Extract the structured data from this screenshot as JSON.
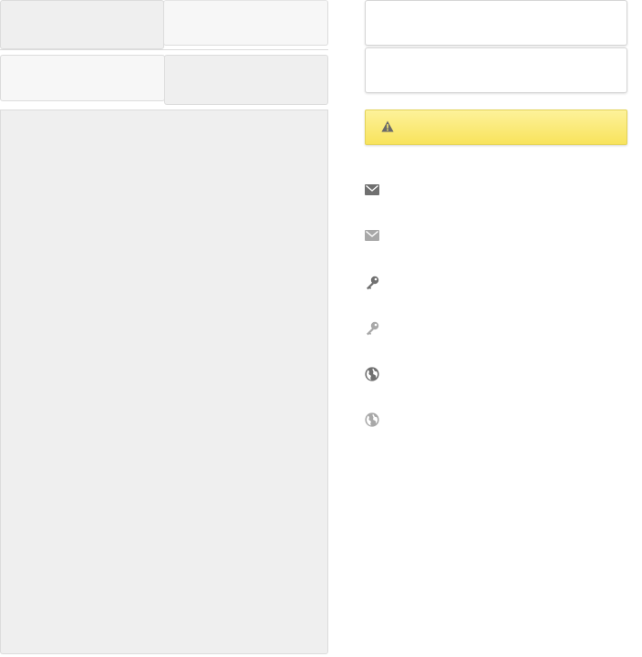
{
  "tabs_row_1": [
    {
      "label": ""
    },
    {
      "label": ""
    }
  ],
  "tabs_row_2": [
    {
      "label": ""
    },
    {
      "label": ""
    }
  ],
  "content_panel": {
    "text": ""
  },
  "fields": [
    {
      "value": "",
      "placeholder": ""
    },
    {
      "value": "",
      "placeholder": ""
    }
  ],
  "warning": {
    "icon": "warning-triangle-icon",
    "text": "",
    "color": "#fbe97a"
  },
  "actions": [
    {
      "icon": "mail-icon",
      "label": ""
    },
    {
      "icon": "mail-icon",
      "label": ""
    },
    {
      "icon": "key-icon",
      "label": ""
    },
    {
      "icon": "key-icon",
      "label": ""
    },
    {
      "icon": "globe-icon",
      "label": ""
    },
    {
      "icon": "globe-icon",
      "label": ""
    }
  ],
  "colors": {
    "panel_bg": "#efefef",
    "tab_light": "#f7f7f7",
    "border": "#dcdcdc",
    "icon": "#707070"
  }
}
